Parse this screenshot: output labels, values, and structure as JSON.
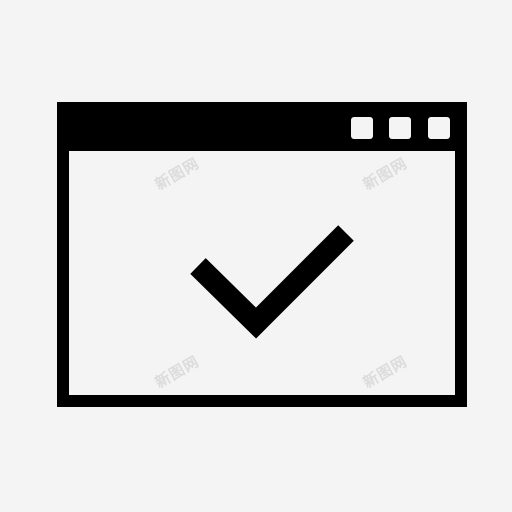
{
  "icon": {
    "name": "browser-window-check-icon",
    "stroke_color": "#000000",
    "fill_color": "#000000",
    "background_color": "#f4f4f4"
  },
  "window": {
    "controls": [
      "square-icon",
      "square-icon",
      "square-icon"
    ]
  },
  "content": {
    "icon": "checkmark-icon"
  },
  "watermarks": [
    {
      "text": "新图网"
    },
    {
      "text": "新图网"
    },
    {
      "text": "新图网"
    },
    {
      "text": "新图网"
    }
  ]
}
